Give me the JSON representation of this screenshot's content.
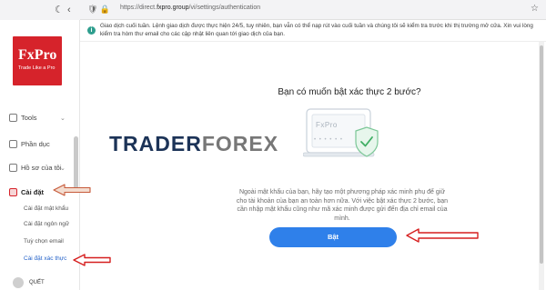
{
  "browser": {
    "url_prefix": "https://direct.",
    "url_domain": "fxpro.group",
    "url_path": "/vi/settings/authentication"
  },
  "sidebar": {
    "logo_name": "FxPro",
    "logo_tagline": "Trade Like a Pro",
    "nav_items": [
      {
        "label": "Tools"
      },
      {
        "label": "Phần dục"
      },
      {
        "label": "Hồ sơ của tôi"
      },
      {
        "label": "Cài đặt"
      }
    ],
    "sub_items": [
      {
        "label": "Cài đặt mật khẩu"
      },
      {
        "label": "Cài đặt ngôn ngữ"
      },
      {
        "label": "Tuỳ chọn email"
      },
      {
        "label": "Cài đặt xác thực"
      }
    ],
    "bottom_label": "QUẾT"
  },
  "notice": {
    "text": "Giao dịch cuối tuần. Lệnh giao dịch được thực hiện 24/5, tuy nhiên, bạn vẫn có thể nạp rút vào cuối tuần và chúng tôi sẽ kiểm tra trước khi thị trường mở cửa. Xin vui lòng kiểm tra hòm thư email cho các cập nhật liên quan tới giao dịch của bạn."
  },
  "main": {
    "title": "Bạn có muốn bật xác thực 2 bước?",
    "illustration_text": "FxPro",
    "illustration_password": "• • • • • •",
    "description": "Ngoài mật khẩu của bạn, hãy tạo một phương pháp xác minh phụ để giữ cho tài khoản của bạn an toàn hơn nữa. Với việc bật xác thực 2 bước, bạn cần nhập mật khẩu cũng như mã xác minh được gửi đến địa chỉ email của mình.",
    "button_label": "Bật"
  },
  "watermark": {
    "part1": "TRADER",
    "part2": "FOREX"
  },
  "colors": {
    "brand_red": "#d6232b",
    "primary_blue": "#2f80ea",
    "arrow_red": "#d61f1f"
  }
}
